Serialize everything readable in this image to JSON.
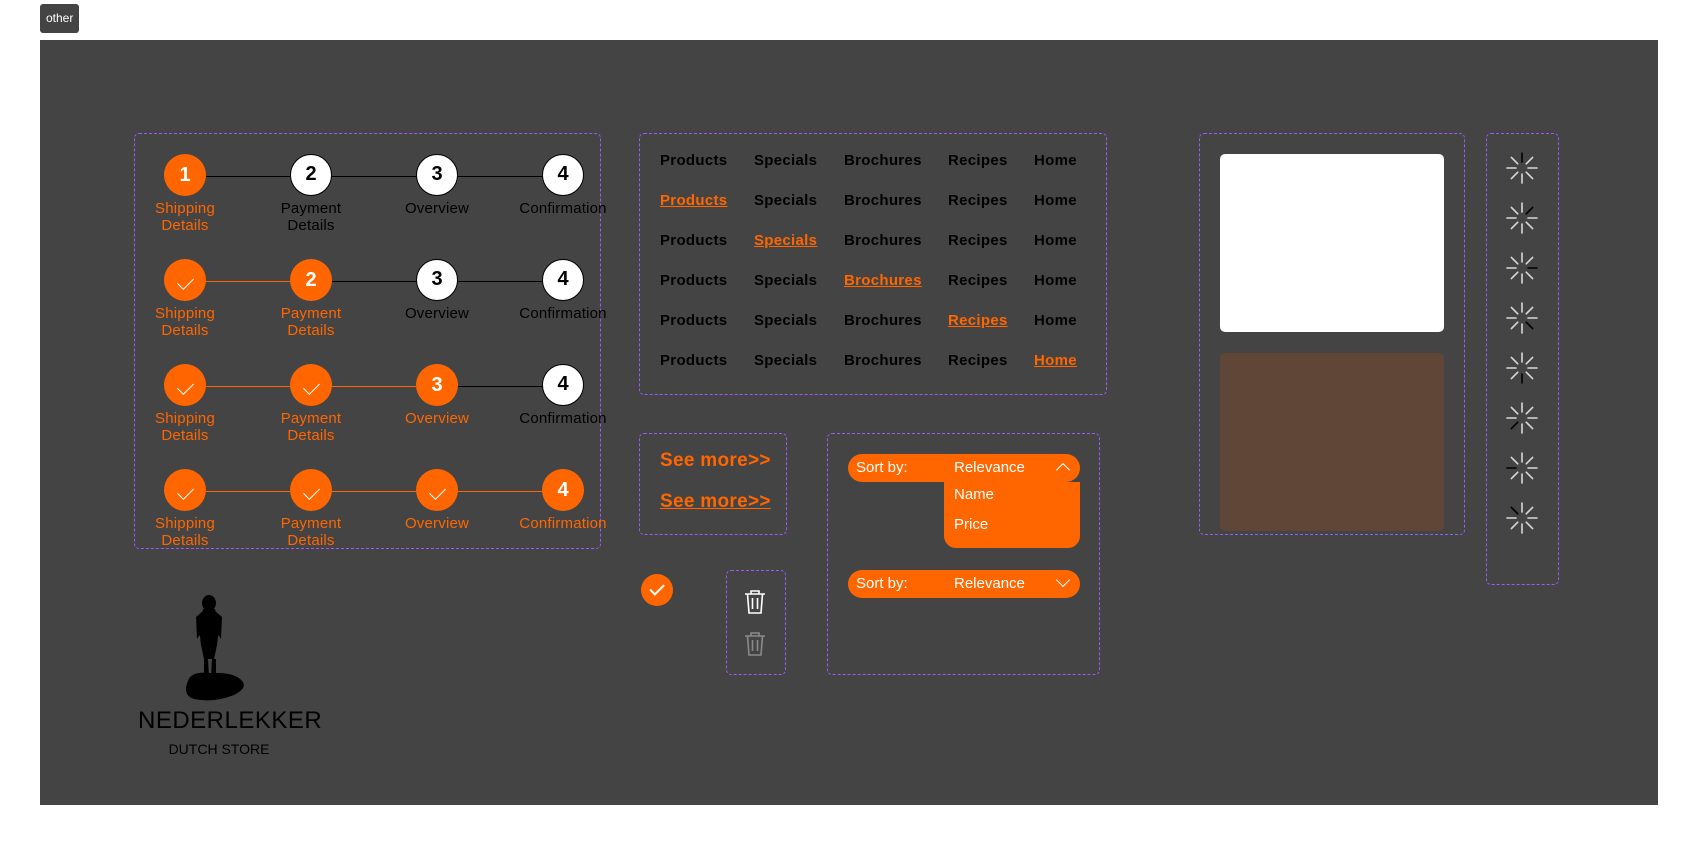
{
  "tag": "other",
  "stepper": {
    "labels": [
      [
        "Shipping",
        "Details"
      ],
      [
        "Payment",
        "Details"
      ],
      [
        "Overview"
      ],
      [
        "Confirmation"
      ]
    ],
    "rows": [
      {
        "states": [
          "active",
          "pending",
          "pending",
          "pending"
        ]
      },
      {
        "states": [
          "done",
          "active",
          "pending",
          "pending"
        ]
      },
      {
        "states": [
          "done",
          "done",
          "active",
          "pending"
        ]
      },
      {
        "states": [
          "done",
          "done",
          "done",
          "active"
        ]
      }
    ]
  },
  "nav": {
    "items": [
      "Products",
      "Specials",
      "Brochures",
      "Recipes",
      "Home"
    ],
    "active_rows": [
      -1,
      0,
      1,
      2,
      3,
      4
    ]
  },
  "see_more": {
    "label": "See more>>"
  },
  "sort": {
    "label": "Sort by:",
    "value": "Relevance",
    "options": [
      "Name",
      "Price"
    ]
  },
  "cards": {
    "top_color": "#ffffff",
    "bottom_color": "#5f4637"
  },
  "logo": {
    "brand": "NEDERLEKKER",
    "tagline": "DUTCH STORE"
  },
  "colors": {
    "accent": "#ff6600",
    "background": "#444444",
    "frame": "#9b5cf6"
  },
  "spinner_count": 8
}
